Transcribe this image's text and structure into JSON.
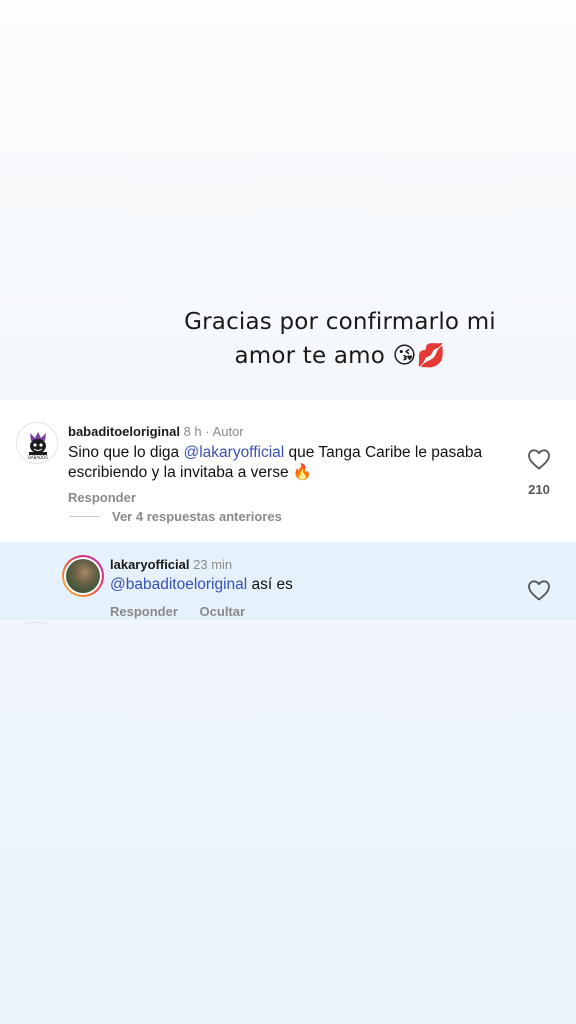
{
  "story": {
    "caption": "Gracias por confirmarlo mi amor te amo 😘💋"
  },
  "comment": {
    "avatar_label": "BABADOS",
    "username": "babaditoeloriginal",
    "time": "8 h",
    "separator": "·",
    "author_tag": "Autor",
    "text_prefix": "Sino que lo diga ",
    "mention": "@lakaryofficial",
    "text_suffix": "  que Tanga Caribe le pasaba escribiendo y la invitaba a verse 🔥",
    "reply_label": "Responder",
    "view_replies_label": "Ver 4 respuestas anteriores",
    "likes": "210",
    "heart_icon": "heart-outline-icon"
  },
  "reply": {
    "username": "lakaryofficial",
    "time": "23 min",
    "mention": "@babaditoeloriginal",
    "text": " así es",
    "reply_label": "Responder",
    "hide_label": "Ocultar",
    "heart_icon": "heart-outline-icon",
    "highlight_color": "#e5f1fb"
  },
  "colors": {
    "mention": "#3a50b8",
    "secondary_text": "#8a8a8a"
  }
}
